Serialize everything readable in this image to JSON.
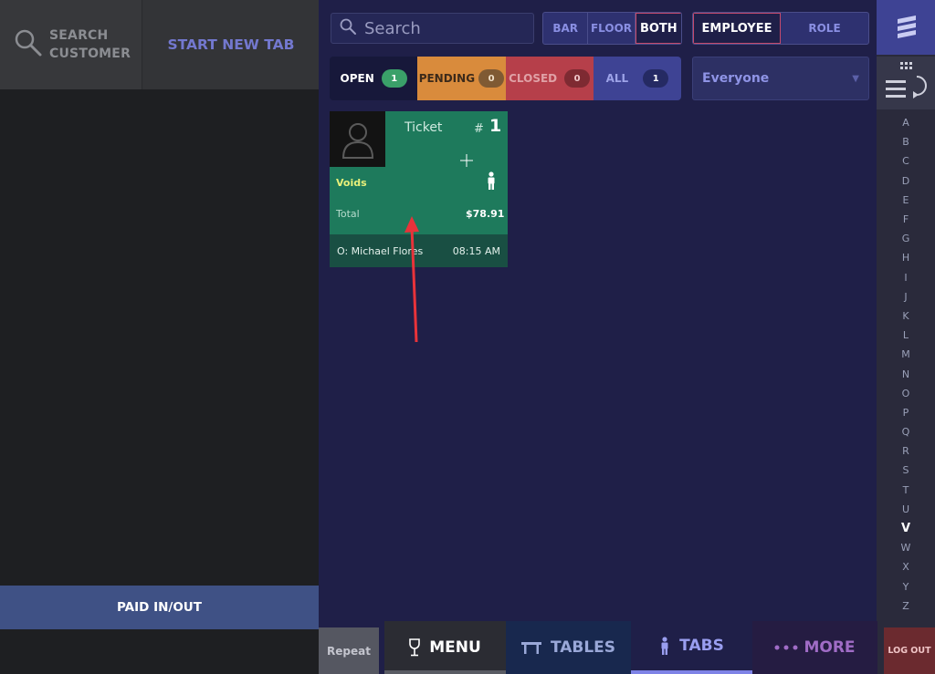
{
  "left": {
    "search_customer_line1": "SEARCH",
    "search_customer_line2": "CUSTOMER",
    "start_new_tab": "START NEW TAB",
    "paid_in_out": "PAID IN/OUT"
  },
  "search": {
    "placeholder": "Search"
  },
  "location_toggle": {
    "bar": "BAR",
    "floor": "FLOOR",
    "both": "BOTH",
    "selected": "BOTH"
  },
  "group_toggle": {
    "employee": "EMPLOYEE",
    "role": "ROLE",
    "selected": "EMPLOYEE"
  },
  "status_filters": [
    {
      "label": "OPEN",
      "count": "1"
    },
    {
      "label": "PENDING",
      "count": "0"
    },
    {
      "label": "CLOSED",
      "count": "0"
    },
    {
      "label": "ALL",
      "count": "1"
    }
  ],
  "employee_dropdown": {
    "value": "Everyone"
  },
  "ticket": {
    "label": "Ticket",
    "hash": "#",
    "number": "1",
    "voids": "Voids",
    "total_label": "Total",
    "total_value": "$78.91",
    "owner": "O: Michael Flores",
    "time": "08:15 AM"
  },
  "alphabet": [
    "A",
    "B",
    "C",
    "D",
    "E",
    "F",
    "G",
    "H",
    "I",
    "J",
    "K",
    "L",
    "M",
    "N",
    "O",
    "P",
    "Q",
    "R",
    "S",
    "T",
    "U",
    "V",
    "W",
    "X",
    "Y",
    "Z"
  ],
  "alphabet_highlighted": "V",
  "bottom_nav": {
    "repeat": "Repeat",
    "menu": "MENU",
    "tables": "TABLES",
    "tabs": "TABS",
    "more": "MORE",
    "logout": "LOG OUT"
  },
  "colors": {
    "background": "#1f1f48",
    "ticket_open": "#1e7a5c",
    "pending": "#d98b3c",
    "closed": "#b63f4a",
    "accent": "#3e4394",
    "annotation_arrow": "#e8333a"
  }
}
